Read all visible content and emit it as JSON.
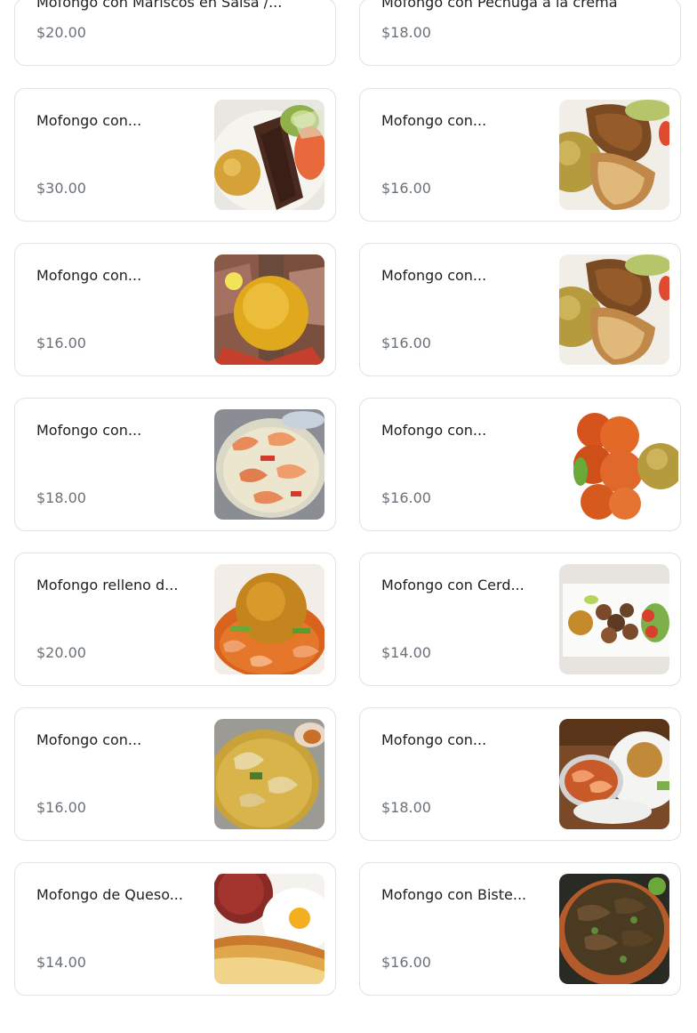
{
  "items": [
    {
      "name": "Mofongo con Mariscos en Salsa /...",
      "price": "$20.00",
      "image": "seafood-mofongo-photo"
    },
    {
      "name": "Mofongo con Pechuga a la crema",
      "price": "$18.00",
      "image": "chicken-breast-cream-photo"
    },
    {
      "name": "Mofongo con...",
      "price": "$30.00",
      "image": "steak-avocado-photo"
    },
    {
      "name": "Mofongo con...",
      "price": "$16.00",
      "image": "fried-chicken-mofongo-photo"
    },
    {
      "name": "Mofongo con...",
      "price": "$16.00",
      "image": "pork-mofongo-photo"
    },
    {
      "name": "Mofongo con...",
      "price": "$16.00",
      "image": "fried-chicken-mofongo-photo"
    },
    {
      "name": "Mofongo con...",
      "price": "$18.00",
      "image": "shrimp-garlic-photo"
    },
    {
      "name": "Mofongo con...",
      "price": "$16.00",
      "image": "crispy-chicken-photo"
    },
    {
      "name": "Mofongo relleno d...",
      "price": "$20.00",
      "image": "stuffed-mofongo-shrimp-photo"
    },
    {
      "name": "Mofongo con Cerd...",
      "price": "$14.00",
      "image": "pork-chunks-plate-photo"
    },
    {
      "name": "Mofongo con...",
      "price": "$16.00",
      "image": "chicken-stew-photo"
    },
    {
      "name": "Mofongo con...",
      "price": "$18.00",
      "image": "shrimp-sauce-plate-photo"
    },
    {
      "name": "Mofongo de Queso...",
      "price": "$14.00",
      "image": "cheese-salami-egg-photo"
    },
    {
      "name": "Mofongo con Biste...",
      "price": "$16.00",
      "image": "steak-onion-photo"
    }
  ]
}
